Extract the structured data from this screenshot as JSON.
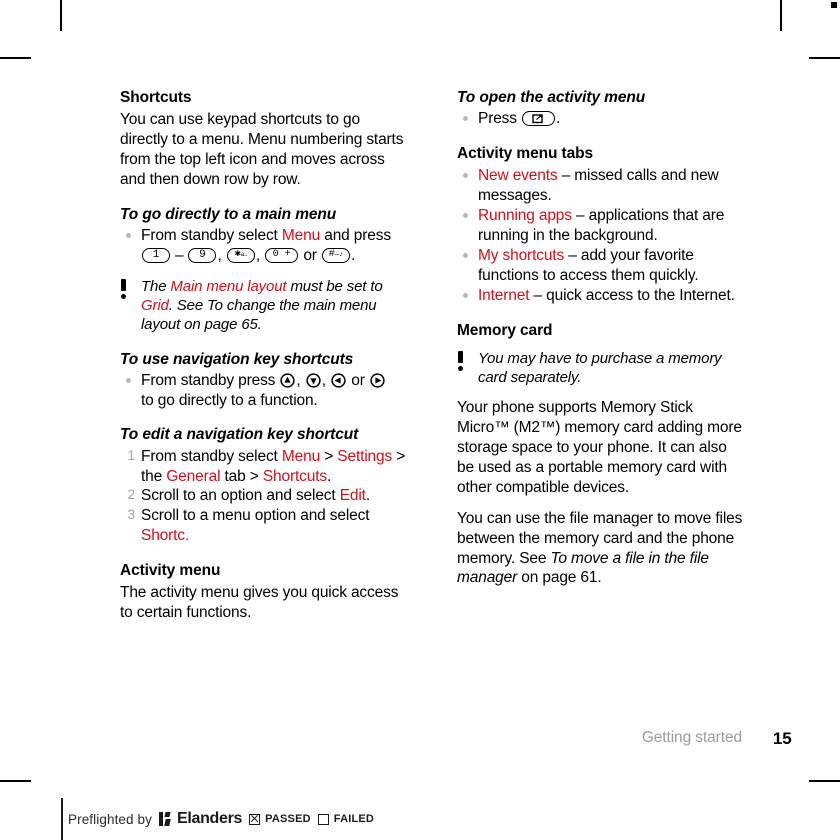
{
  "document": {
    "footer": {
      "section": "Getting started",
      "page_number": "15"
    }
  },
  "left_column": {
    "shortcuts": {
      "heading": "Shortcuts",
      "intro": "You can use keypad shortcuts to go directly to a menu. Menu numbering starts from the top left icon and moves across and then down row by row."
    },
    "go_directly": {
      "heading": "To go directly to a main menu",
      "text_before": "From standby select ",
      "link": "Menu",
      "text_after": " and press",
      "key_1": "1",
      "dash": "–",
      "key_9": "9",
      "key_star": "*",
      "key_star_sub": "a/A",
      "key_0": "0 +",
      "or": "or",
      "key_hash": "#",
      "key_hash_sub": "—♪",
      "period": "."
    },
    "note": {
      "icon": "exclamation-icon",
      "part1": "The ",
      "link1": "Main menu layout",
      "part2": " must be set to ",
      "link2": "Grid",
      "part3": ". See To change the main menu layout on page 65."
    },
    "nav_shortcuts": {
      "heading": "To use navigation key shortcuts",
      "text_before": "From standby press ",
      "keys": [
        "nav-up-key",
        "nav-down-key",
        "nav-left-key",
        "nav-right-key"
      ],
      "or": "or",
      "text_after": "to go directly to a function."
    },
    "edit_nav": {
      "heading": "To edit a navigation key shortcut",
      "steps": [
        {
          "number": "1",
          "segments": [
            {
              "text": "From standby select ",
              "style": "plain"
            },
            {
              "text": "Menu",
              "style": "link"
            },
            {
              "text": " > ",
              "style": "plain"
            },
            {
              "text": "Settings",
              "style": "link"
            },
            {
              "text": " > the ",
              "style": "plain"
            },
            {
              "text": "General",
              "style": "link"
            },
            {
              "text": " tab > ",
              "style": "plain"
            },
            {
              "text": "Shortcuts",
              "style": "link"
            },
            {
              "text": ".",
              "style": "plain"
            }
          ]
        },
        {
          "number": "2",
          "segments": [
            {
              "text": "Scroll to an option and select ",
              "style": "plain"
            },
            {
              "text": "Edit",
              "style": "link"
            },
            {
              "text": ".",
              "style": "plain"
            }
          ]
        },
        {
          "number": "3",
          "segments": [
            {
              "text": "Scroll to a menu option and select ",
              "style": "plain"
            },
            {
              "text": "Shortc.",
              "style": "link"
            }
          ]
        }
      ]
    },
    "activity_menu": {
      "heading": "Activity menu",
      "text": "The activity menu gives you quick access to certain functions."
    }
  },
  "right_column": {
    "open_activity": {
      "heading": "To open the activity menu",
      "text_before": "Press ",
      "key": "activity-menu-key",
      "text_after": "."
    },
    "activity_tabs": {
      "heading": "Activity menu tabs",
      "items": [
        {
          "link": "New events",
          "rest": " – missed calls and new messages."
        },
        {
          "link": "Running apps",
          "rest": " – applications that are running in the background."
        },
        {
          "link": "My shortcuts",
          "rest": " – add your favorite functions to access them quickly."
        },
        {
          "link": "Internet",
          "rest": " – quick access to the Internet."
        }
      ]
    },
    "memory_card": {
      "heading": "Memory card",
      "note": "You may have to purchase a memory card separately.",
      "paragraph1": "Your phone supports Memory Stick Micro™ (M2™) memory card adding more storage space to your phone. It can also be used as a portable memory card with other compatible devices.",
      "paragraph2_before": "You can use the file manager to move files between the memory card and the phone memory. See ",
      "paragraph2_italic": "To move a file in the file manager",
      "paragraph2_after": " on page 61."
    }
  },
  "preflight": {
    "text": "Preflighted by",
    "brand": "Elanders",
    "passed_label": "PASSED",
    "failed_label": "FAILED",
    "passed_checked": true,
    "failed_checked": false
  },
  "colors": {
    "link_red": "#d0111b",
    "muted_gray": "#9c9c9c",
    "bullet_gray": "#b9b9b9"
  }
}
